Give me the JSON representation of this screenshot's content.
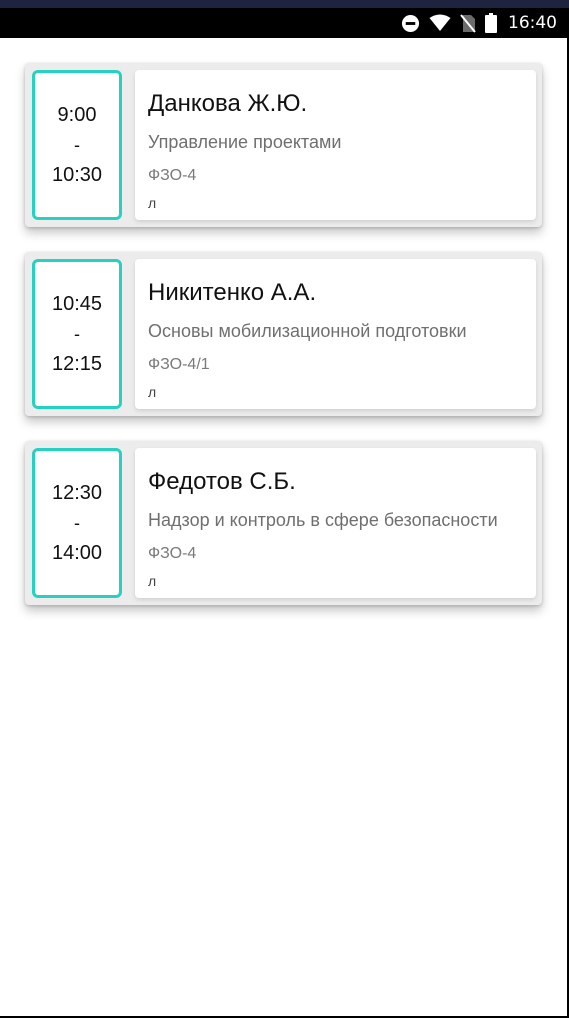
{
  "status_bar": {
    "time": "16:40",
    "icons": [
      "do-not-disturb-icon",
      "wifi-icon",
      "no-sim-icon",
      "battery-icon"
    ]
  },
  "accent_color": "#25d2c2",
  "lessons": [
    {
      "start": "9:00",
      "separator": "-",
      "end": "10:30",
      "teacher": "Данкова Ж.Ю.",
      "subject": "Управление проектами",
      "room": "ФЗО-4",
      "kind": "л"
    },
    {
      "start": "10:45",
      "separator": "-",
      "end": "12:15",
      "teacher": "Никитенко А.А.",
      "subject": "Основы мобилизационной подготовки",
      "room": "ФЗО-4/1",
      "kind": "л"
    },
    {
      "start": "12:30",
      "separator": "-",
      "end": "14:00",
      "teacher": "Федотов С.Б.",
      "subject": "Надзор и контроль в сфере безопасности",
      "room": "ФЗО-4",
      "kind": "л"
    }
  ]
}
